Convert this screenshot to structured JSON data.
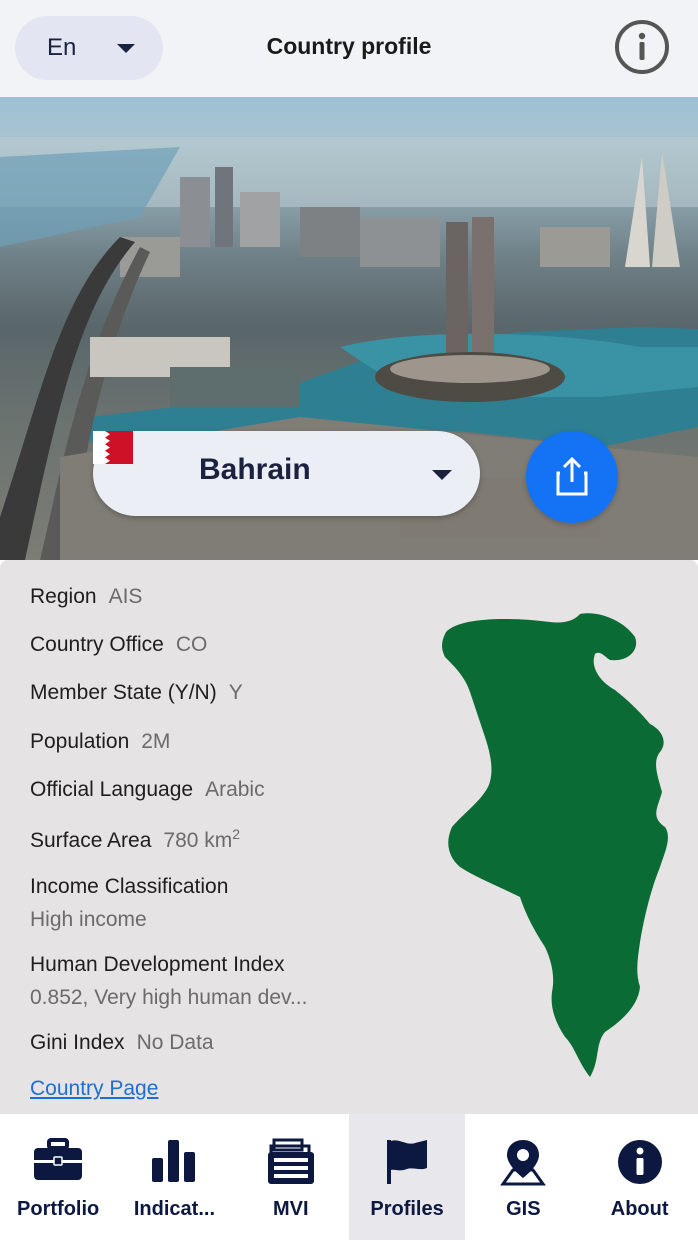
{
  "header": {
    "language": "En",
    "title": "Country profile"
  },
  "hero": {
    "country": "Bahrain"
  },
  "details": {
    "region_label": "Region",
    "region_value": "AIS",
    "country_office_label": "Country Office",
    "country_office_value": "CO",
    "member_state_label": "Member State (Y/N)",
    "member_state_value": "Y",
    "population_label": "Population",
    "population_value": "2M",
    "official_language_label": "Official Language",
    "official_language_value": "Arabic",
    "surface_area_label": "Surface Area",
    "surface_area_value": "780 km",
    "surface_area_unit_sup": "2",
    "income_label": "Income Classification",
    "income_value": "High income",
    "hdi_label": "Human Development Index",
    "hdi_value": "0.852, Very high human dev...",
    "gini_label": "Gini Index",
    "gini_value": "No Data",
    "country_page_link": "Country Page"
  },
  "bottom_nav": {
    "items": [
      {
        "label": "Portfolio",
        "icon": "briefcase-icon"
      },
      {
        "label": "Indicat...",
        "icon": "bar-chart-icon"
      },
      {
        "label": "MVI",
        "icon": "file-cabinet-icon"
      },
      {
        "label": "Profiles",
        "icon": "flag-icon",
        "active": true
      },
      {
        "label": "GIS",
        "icon": "map-pin-icon"
      },
      {
        "label": "About",
        "icon": "info-icon"
      }
    ]
  },
  "colors": {
    "accent_blue": "#1472f5",
    "nav_navy": "#0d1840",
    "map_green": "#0b6b34",
    "flag_red": "#ce1126"
  }
}
